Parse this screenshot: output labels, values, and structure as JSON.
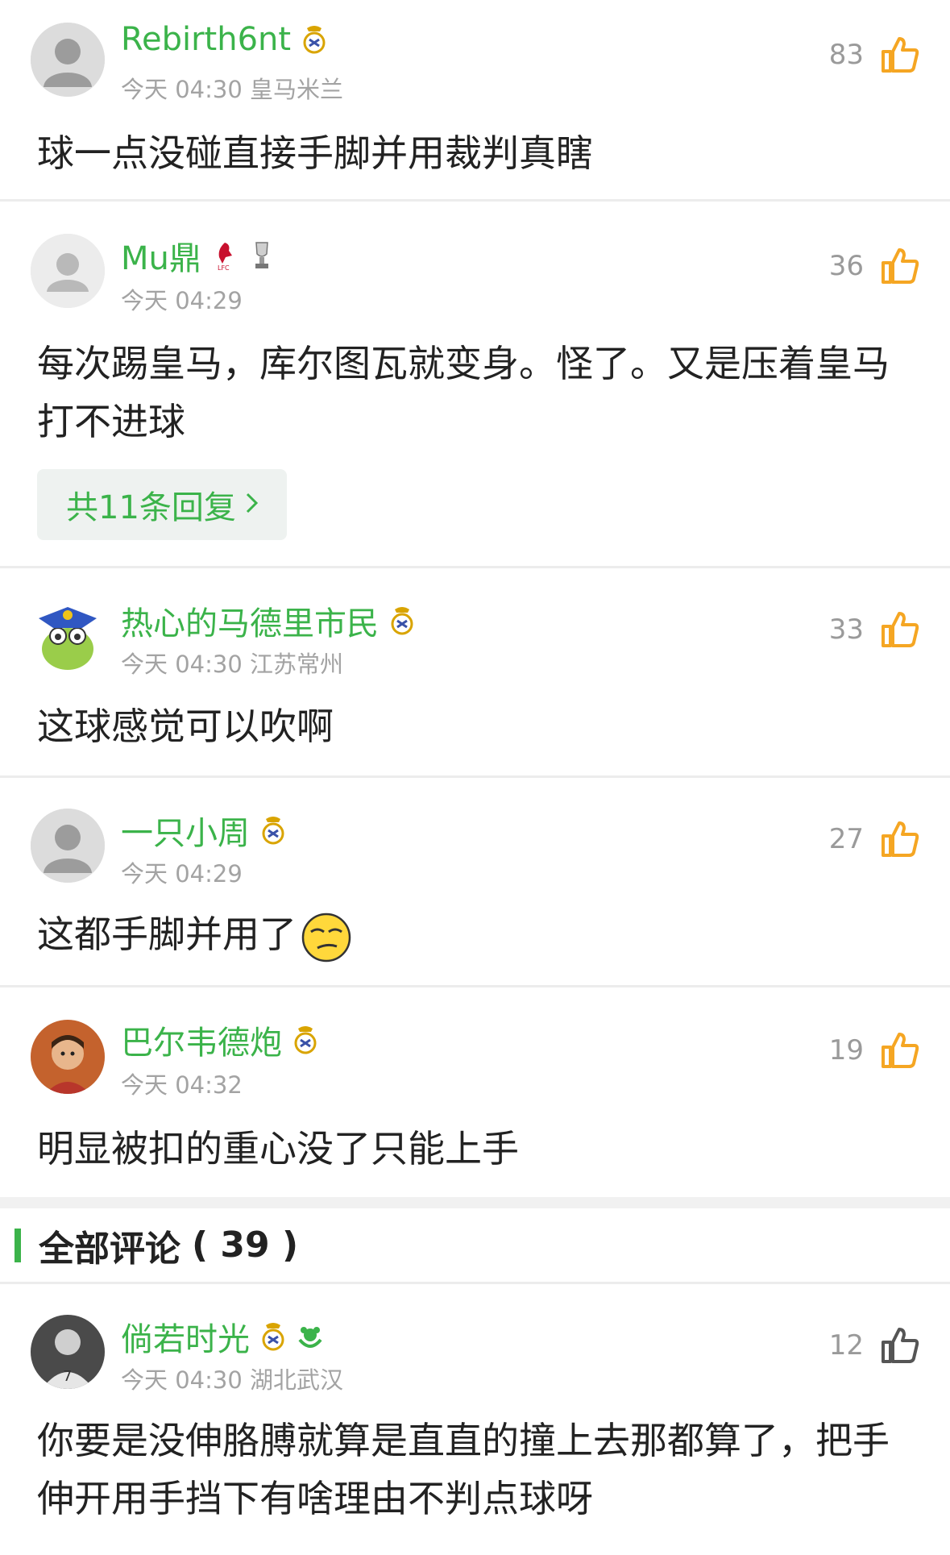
{
  "hot_comments": [
    {
      "username": "Rebirth6nt",
      "meta": "今天 04:30 皇马米兰",
      "likes": "83",
      "text": "球一点没碰直接手脚并用裁判真瞎"
    },
    {
      "username": "Mu鼎",
      "meta": "今天 04:29",
      "likes": "36",
      "text": "每次踢皇马，库尔图瓦就变身。怪了。又是压着皇马打不进球",
      "replies_label": "共11条回复"
    },
    {
      "username": "热心的马德里市民",
      "meta": "今天 04:30 江苏常州",
      "likes": "33",
      "text": "这球感觉可以吹啊"
    },
    {
      "username": "一只小周",
      "meta": "今天 04:29",
      "likes": "27",
      "text": "这都手脚并用了"
    },
    {
      "username": "巴尔韦德炮",
      "meta": "今天 04:32",
      "likes": "19",
      "text": "明显被扣的重心没了只能上手"
    }
  ],
  "all_comments_section": {
    "title": "全部评论",
    "count": "( 39 )"
  },
  "all_comments": [
    {
      "username": "倘若时光",
      "meta": "今天 04:30 湖北武汉",
      "likes": "12",
      "text": "你要是没伸胳膊就算是直直的撞上去那都算了，把手伸开用手挡下有啥理由不判点球呀"
    }
  ],
  "icons": {
    "like": "thumbs-up-icon",
    "chevron": "chevron-right-icon",
    "badge_real_madrid": "real-madrid-crest-icon",
    "badge_liverpool": "liverpool-crest-icon",
    "badge_trophy": "premier-league-trophy-icon",
    "badge_green": "green-club-icon",
    "emoji": "smirk-emoji-icon"
  },
  "colors": {
    "accent": "#3bb34a",
    "like_active": "#f5a623",
    "like_inactive": "#555555",
    "meta_gray": "#a3a3a3",
    "divider": "#ececec"
  }
}
